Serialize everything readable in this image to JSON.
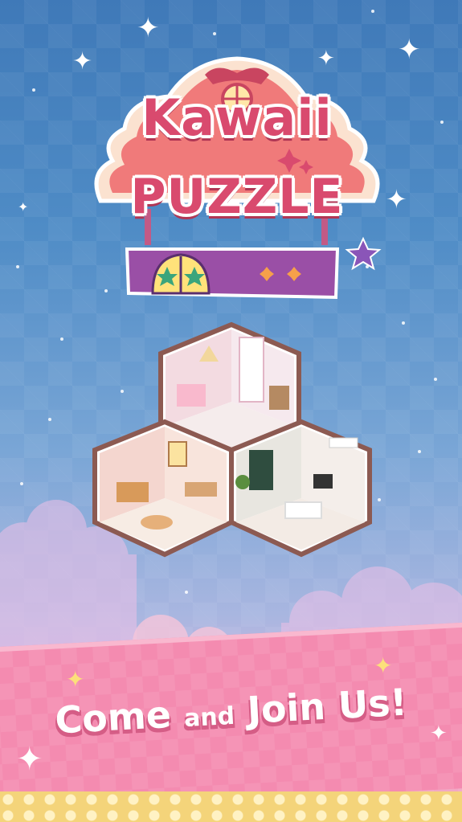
{
  "logo": {
    "line1": "Kawaii",
    "line2": "PUZZLE"
  },
  "banner": {
    "tagline_part1": "Come",
    "tagline_part2": "and",
    "tagline_part3": "Join Us!"
  },
  "colors": {
    "sky_top": "#3f79b8",
    "logo_roof": "#f07a7a",
    "logo_text": "#d94a6e",
    "sign_board": "#9a4fa6",
    "banner_pink": "#f48bb0",
    "bottom_gold": "#f4d47a"
  },
  "icons": {
    "sparkle": "sparkle-icon",
    "star": "star-icon"
  }
}
